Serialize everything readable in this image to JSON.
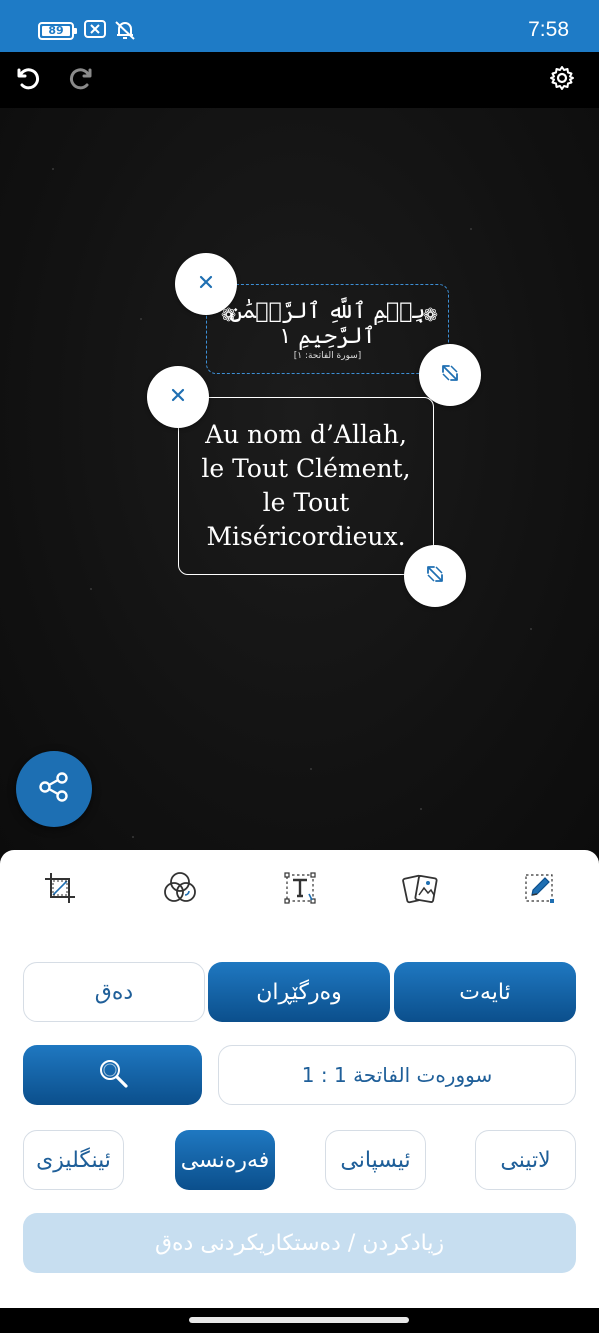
{
  "status_bar": {
    "battery_level": "89",
    "time": "7:58",
    "icons": [
      "battery-icon",
      "close-box-icon",
      "bell-off-icon"
    ]
  },
  "toolbar": {
    "icons": [
      "undo-icon",
      "redo-icon",
      "settings-gear-icon"
    ]
  },
  "canvas": {
    "verse_arabic": "بِسۡمِ ٱللَّهِ ٱلرَّحۡمَٰنِ ٱلرَّحِيمِ ١",
    "verse_reference": "[سورة الفاتحة: ١]",
    "translation": "Au nom d’Allah, le Tout Clément, le Tout Miséricordieux."
  },
  "editor_tools": [
    "crop-icon",
    "color-filters-icon",
    "text-format-icon",
    "background-images-icon",
    "edit-pencil-icon"
  ],
  "tabs": {
    "verse": "ئایەت",
    "translation": "وەرگێڕان",
    "text": "دەق"
  },
  "search": {
    "surah_value": "سوورەت الفاتحة 1 : 1"
  },
  "languages": {
    "latin": "لاتینی",
    "spanish": "ئیسپانی",
    "french": "فەرەنسی",
    "english": "ئینگلیزی"
  },
  "add_text_label": "زیادکردن / دەستکاریکردنی دەق",
  "colors": {
    "accent": "#1f78c1",
    "accent_dark": "#0b4f8c",
    "status_bar": "#1e7bc6",
    "disabled": "#c7def0"
  }
}
